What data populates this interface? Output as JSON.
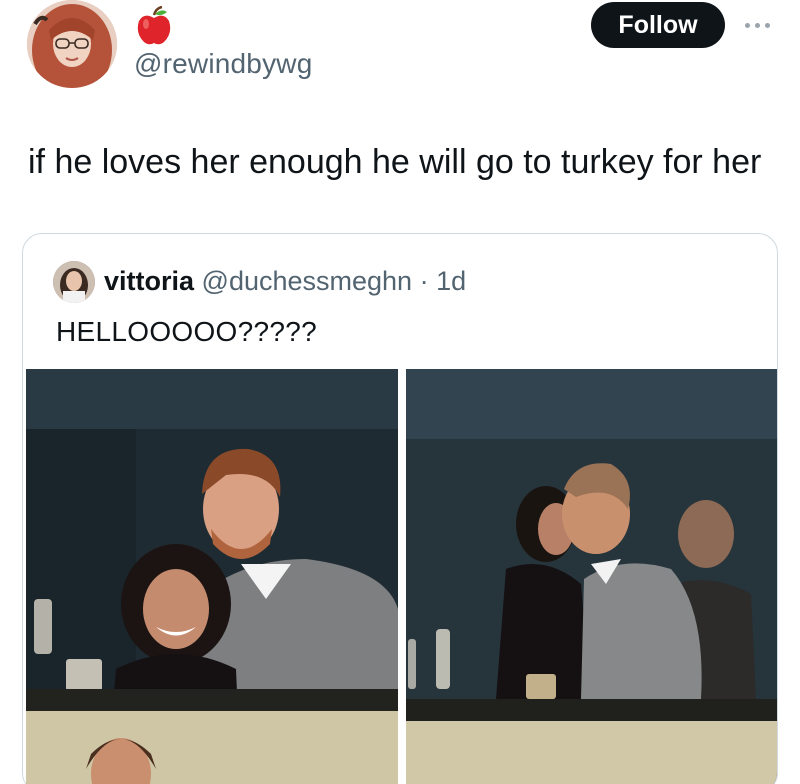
{
  "author": {
    "handle": "@rewindbywg",
    "avatar_icon": "profile-avatar",
    "badge_icon": "red-apple-icon"
  },
  "follow_label": "Follow",
  "more_icon": "more-options-icon",
  "tweet_text": "if he loves her enough he will go to turkey for her",
  "quote": {
    "name": "vittoria",
    "handle": "@duchessmeghn",
    "separator": "·",
    "time": "1d",
    "text": "HELLOOOOO?????",
    "photos": [
      "couple-smiling-photo",
      "couple-kissing-photo"
    ]
  },
  "colors": {
    "text_primary": "#0f1419",
    "text_secondary": "#536471",
    "border": "#cfd9de",
    "follow_bg": "#0f1419"
  }
}
